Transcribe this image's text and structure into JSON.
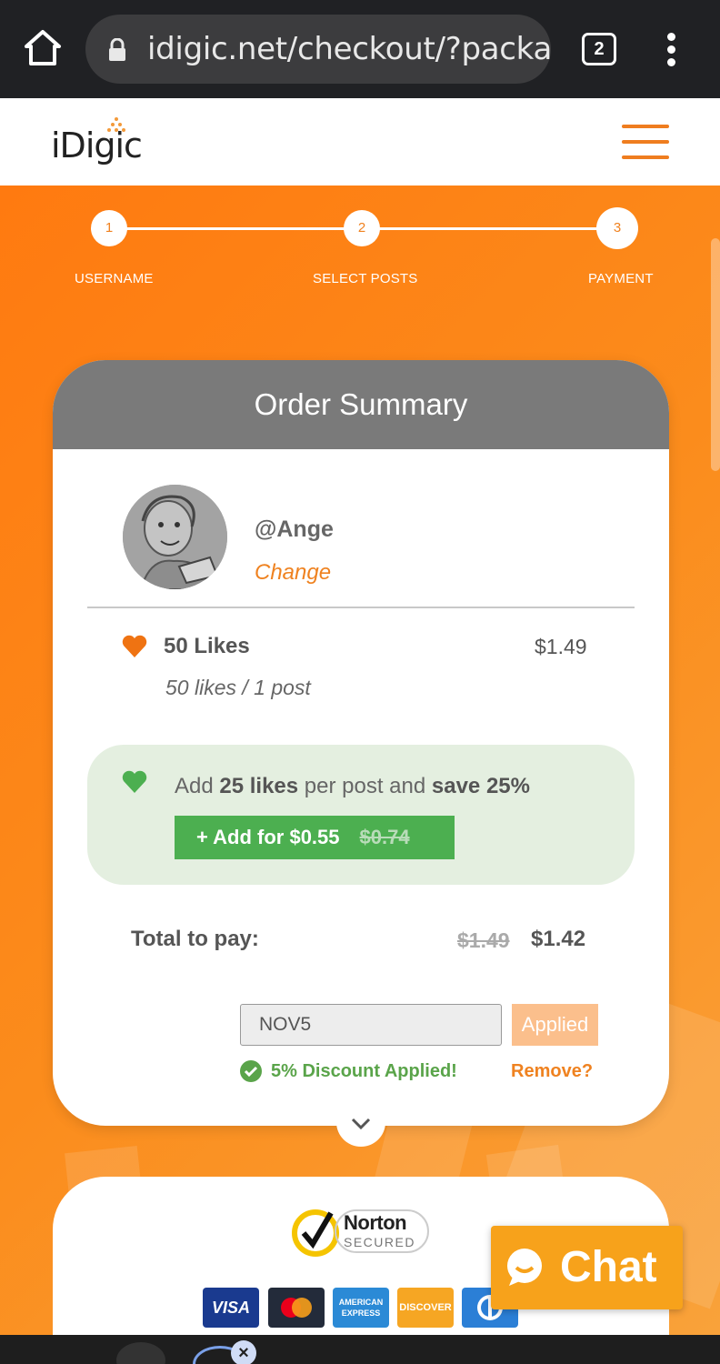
{
  "browser": {
    "url": "idigic.net/checkout/?package",
    "tab_count": "2",
    "icons": {
      "home": "home-icon",
      "lock": "lock-icon",
      "menu": "more-vert-icon"
    }
  },
  "header": {
    "logo_text": "iDigic",
    "menu_icon": "hamburger-icon",
    "accent": "#ef7d1f"
  },
  "steps": [
    {
      "number": "1",
      "label": "USERNAME"
    },
    {
      "number": "2",
      "label": "SELECT POSTS"
    },
    {
      "number": "3",
      "label": "PAYMENT"
    }
  ],
  "order": {
    "title": "Order Summary",
    "username": "@Ange",
    "change_label": "Change",
    "item_title": "50 Likes",
    "item_price": "$1.49",
    "item_sub": "50 likes / 1 post",
    "upsell_prefix": "Add ",
    "upsell_bold1": "25 likes",
    "upsell_middle": " per post and ",
    "upsell_bold2": "save 25%",
    "upsell_btn_label": "+  Add for $0.55",
    "upsell_btn_old": "$0.74",
    "total_label": "Total to pay:",
    "total_old": "$1.49",
    "total_new": "$1.42",
    "coupon_value": "NOV5",
    "applied_label": "Applied",
    "discount_msg": "5% Discount Applied!",
    "remove_label": "Remove?"
  },
  "security": {
    "norton_title": "Norton",
    "norton_sub": "SECURED",
    "cards": [
      "VISA",
      "mastercard",
      "AMERICAN EXPRESS",
      "DISCOVER",
      "DINERS"
    ]
  },
  "chat": {
    "label": "Chat"
  },
  "colors": {
    "orange": "#ef8220",
    "green": "#4caf50",
    "header_gray": "#7a7a7a",
    "upsell_bg": "#e4efe0"
  }
}
